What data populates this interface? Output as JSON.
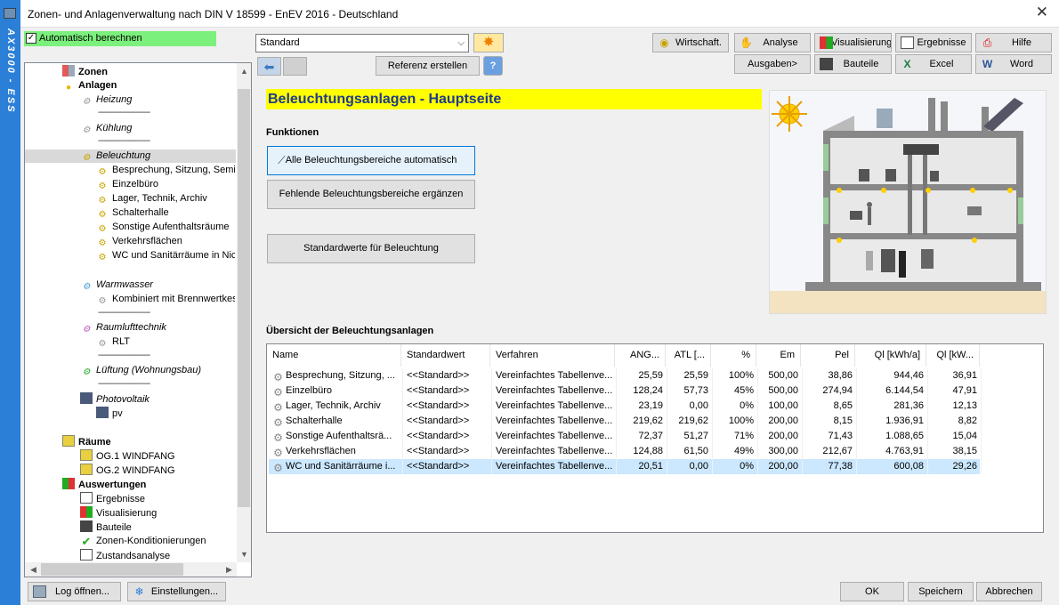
{
  "sidebar_vertical_text": "AX3000 - ESS",
  "window": {
    "title": "Zonen- und Anlagenverwaltung nach DIN V 18599 - EnEV 2016 - Deutschland",
    "close": "✕"
  },
  "auto_calc": {
    "label": "Automatisch berechnen",
    "checked": "✓"
  },
  "tree": {
    "zonen": "Zonen",
    "anlagen": "Anlagen",
    "heizung": "Heizung",
    "kuehlung": "Kühlung",
    "beleuchtung": "Beleuchtung",
    "beleuchtung_items": [
      "Besprechung, Sitzung, Semi",
      "Einzelbüro",
      "Lager, Technik, Archiv",
      "Schalterhalle",
      "Sonstige Aufenthaltsräume",
      "Verkehrsflächen",
      "WC und Sanitärräume in Nic"
    ],
    "warmwasser": "Warmwasser",
    "warmwasser_items": [
      "Kombiniert mit Brennwertkes"
    ],
    "raumluft": "Raumlufttechnik",
    "raumluft_items": [
      "RLT"
    ],
    "lueftung": "Lüftung (Wohnungsbau)",
    "photovoltaik": "Photovoltaik",
    "photovoltaik_items": [
      "pv"
    ],
    "raeume": "Räume",
    "raeume_items": [
      "OG.1 WINDFANG",
      "OG.2 WINDFANG"
    ],
    "auswertungen": "Auswertungen",
    "auswertungen_items": [
      "Ergebnisse",
      "Visualisierung",
      "Bauteile",
      "Zonen-Konditionierungen",
      "Zustandsanalyse"
    ],
    "separator": "-------------------------"
  },
  "toolbar": {
    "combo_value": "Standard",
    "referenz": "Referenz erstellen",
    "wirtschaft": "Wirtschaft.",
    "analyse": "Analyse",
    "visualisierung": "Visualisierung",
    "ergebnisse": "Ergebnisse",
    "hilfe": "Hilfe",
    "ausgaben": "Ausgaben>",
    "bauteile": "Bauteile",
    "excel": "Excel",
    "word": "Word"
  },
  "main": {
    "title": "Beleuchtungsanlagen - Hauptseite",
    "funktionen": "Funktionen",
    "btn_auto": "Alle Beleuchtungsbereiche automatisch",
    "btn_fehlende": "Fehlende Beleuchtungsbereiche ergänzen",
    "btn_standard": "Standardwerte für Beleuchtung",
    "overview": "Übersicht der Beleuchtungsanlagen"
  },
  "grid": {
    "headers": [
      "Name",
      "Standardwert",
      "Verfahren",
      "ANG...",
      "ATL [...",
      "%",
      "Em",
      "Pel",
      "Ql [kWh/a]",
      "Ql [kW..."
    ],
    "rows": [
      [
        "Besprechung, Sitzung, ...",
        "<<Standard>>",
        "Vereinfachtes Tabellenve...",
        "25,59",
        "25,59",
        "100%",
        "500,00",
        "38,86",
        "944,46",
        "36,91"
      ],
      [
        "Einzelbüro",
        "<<Standard>>",
        "Vereinfachtes Tabellenve...",
        "128,24",
        "57,73",
        "45%",
        "500,00",
        "274,94",
        "6.144,54",
        "47,91"
      ],
      [
        "Lager, Technik, Archiv",
        "<<Standard>>",
        "Vereinfachtes Tabellenve...",
        "23,19",
        "0,00",
        "0%",
        "100,00",
        "8,65",
        "281,36",
        "12,13"
      ],
      [
        "Schalterhalle",
        "<<Standard>>",
        "Vereinfachtes Tabellenve...",
        "219,62",
        "219,62",
        "100%",
        "200,00",
        "8,15",
        "1.936,91",
        "8,82"
      ],
      [
        "Sonstige Aufenthaltsrä...",
        "<<Standard>>",
        "Vereinfachtes Tabellenve...",
        "72,37",
        "51,27",
        "71%",
        "200,00",
        "71,43",
        "1.088,65",
        "15,04"
      ],
      [
        "Verkehrsflächen",
        "<<Standard>>",
        "Vereinfachtes Tabellenve...",
        "124,88",
        "61,50",
        "49%",
        "300,00",
        "212,67",
        "4.763,91",
        "38,15"
      ],
      [
        "WC und Sanitärräume i...",
        "<<Standard>>",
        "Vereinfachtes Tabellenve...",
        "20,51",
        "0,00",
        "0%",
        "200,00",
        "77,38",
        "600,08",
        "29,26"
      ]
    ]
  },
  "bottom": {
    "log": "Log öffnen...",
    "einstellungen": "Einstellungen...",
    "ok": "OK",
    "speichern": "Speichern",
    "abbrechen": "Abbrechen"
  },
  "colors": {
    "accent_bar": "#2b7fd6",
    "banner": "#ffff00",
    "banner_text": "#1f3b8a",
    "autocalc": "#7cf07c",
    "selected_row": "#cce8ff"
  }
}
